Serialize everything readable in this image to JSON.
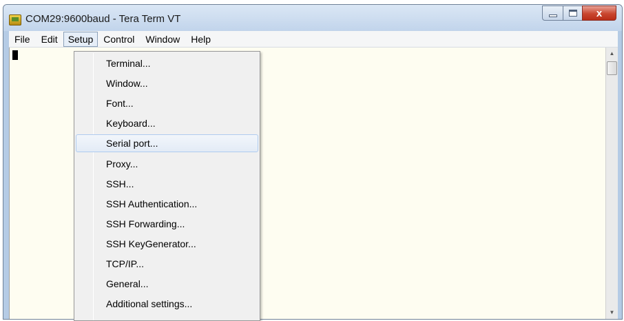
{
  "window": {
    "title": "COM29:9600baud - Tera Term VT",
    "close_label": "x"
  },
  "menubar": {
    "items": [
      "File",
      "Edit",
      "Setup",
      "Control",
      "Window",
      "Help"
    ]
  },
  "setup_menu": {
    "items": [
      "Terminal...",
      "Window...",
      "Font...",
      "Keyboard...",
      "Serial port...",
      "Proxy...",
      "SSH...",
      "SSH Authentication...",
      "SSH Forwarding...",
      "SSH KeyGenerator...",
      "TCP/IP...",
      "General...",
      "Additional settings..."
    ],
    "highlighted": "Serial port..."
  },
  "icons": {
    "app": "tera-term-icon",
    "minimize": "minimize-icon",
    "maximize": "maximize-icon",
    "close": "close-icon",
    "scroll_up": "scroll-up-arrow-icon",
    "scroll_down": "scroll-down-arrow-icon"
  },
  "colors": {
    "terminal_background": "#fefdf1",
    "close_button": "#c9462f",
    "menu_highlight": "#e3ebf6"
  }
}
